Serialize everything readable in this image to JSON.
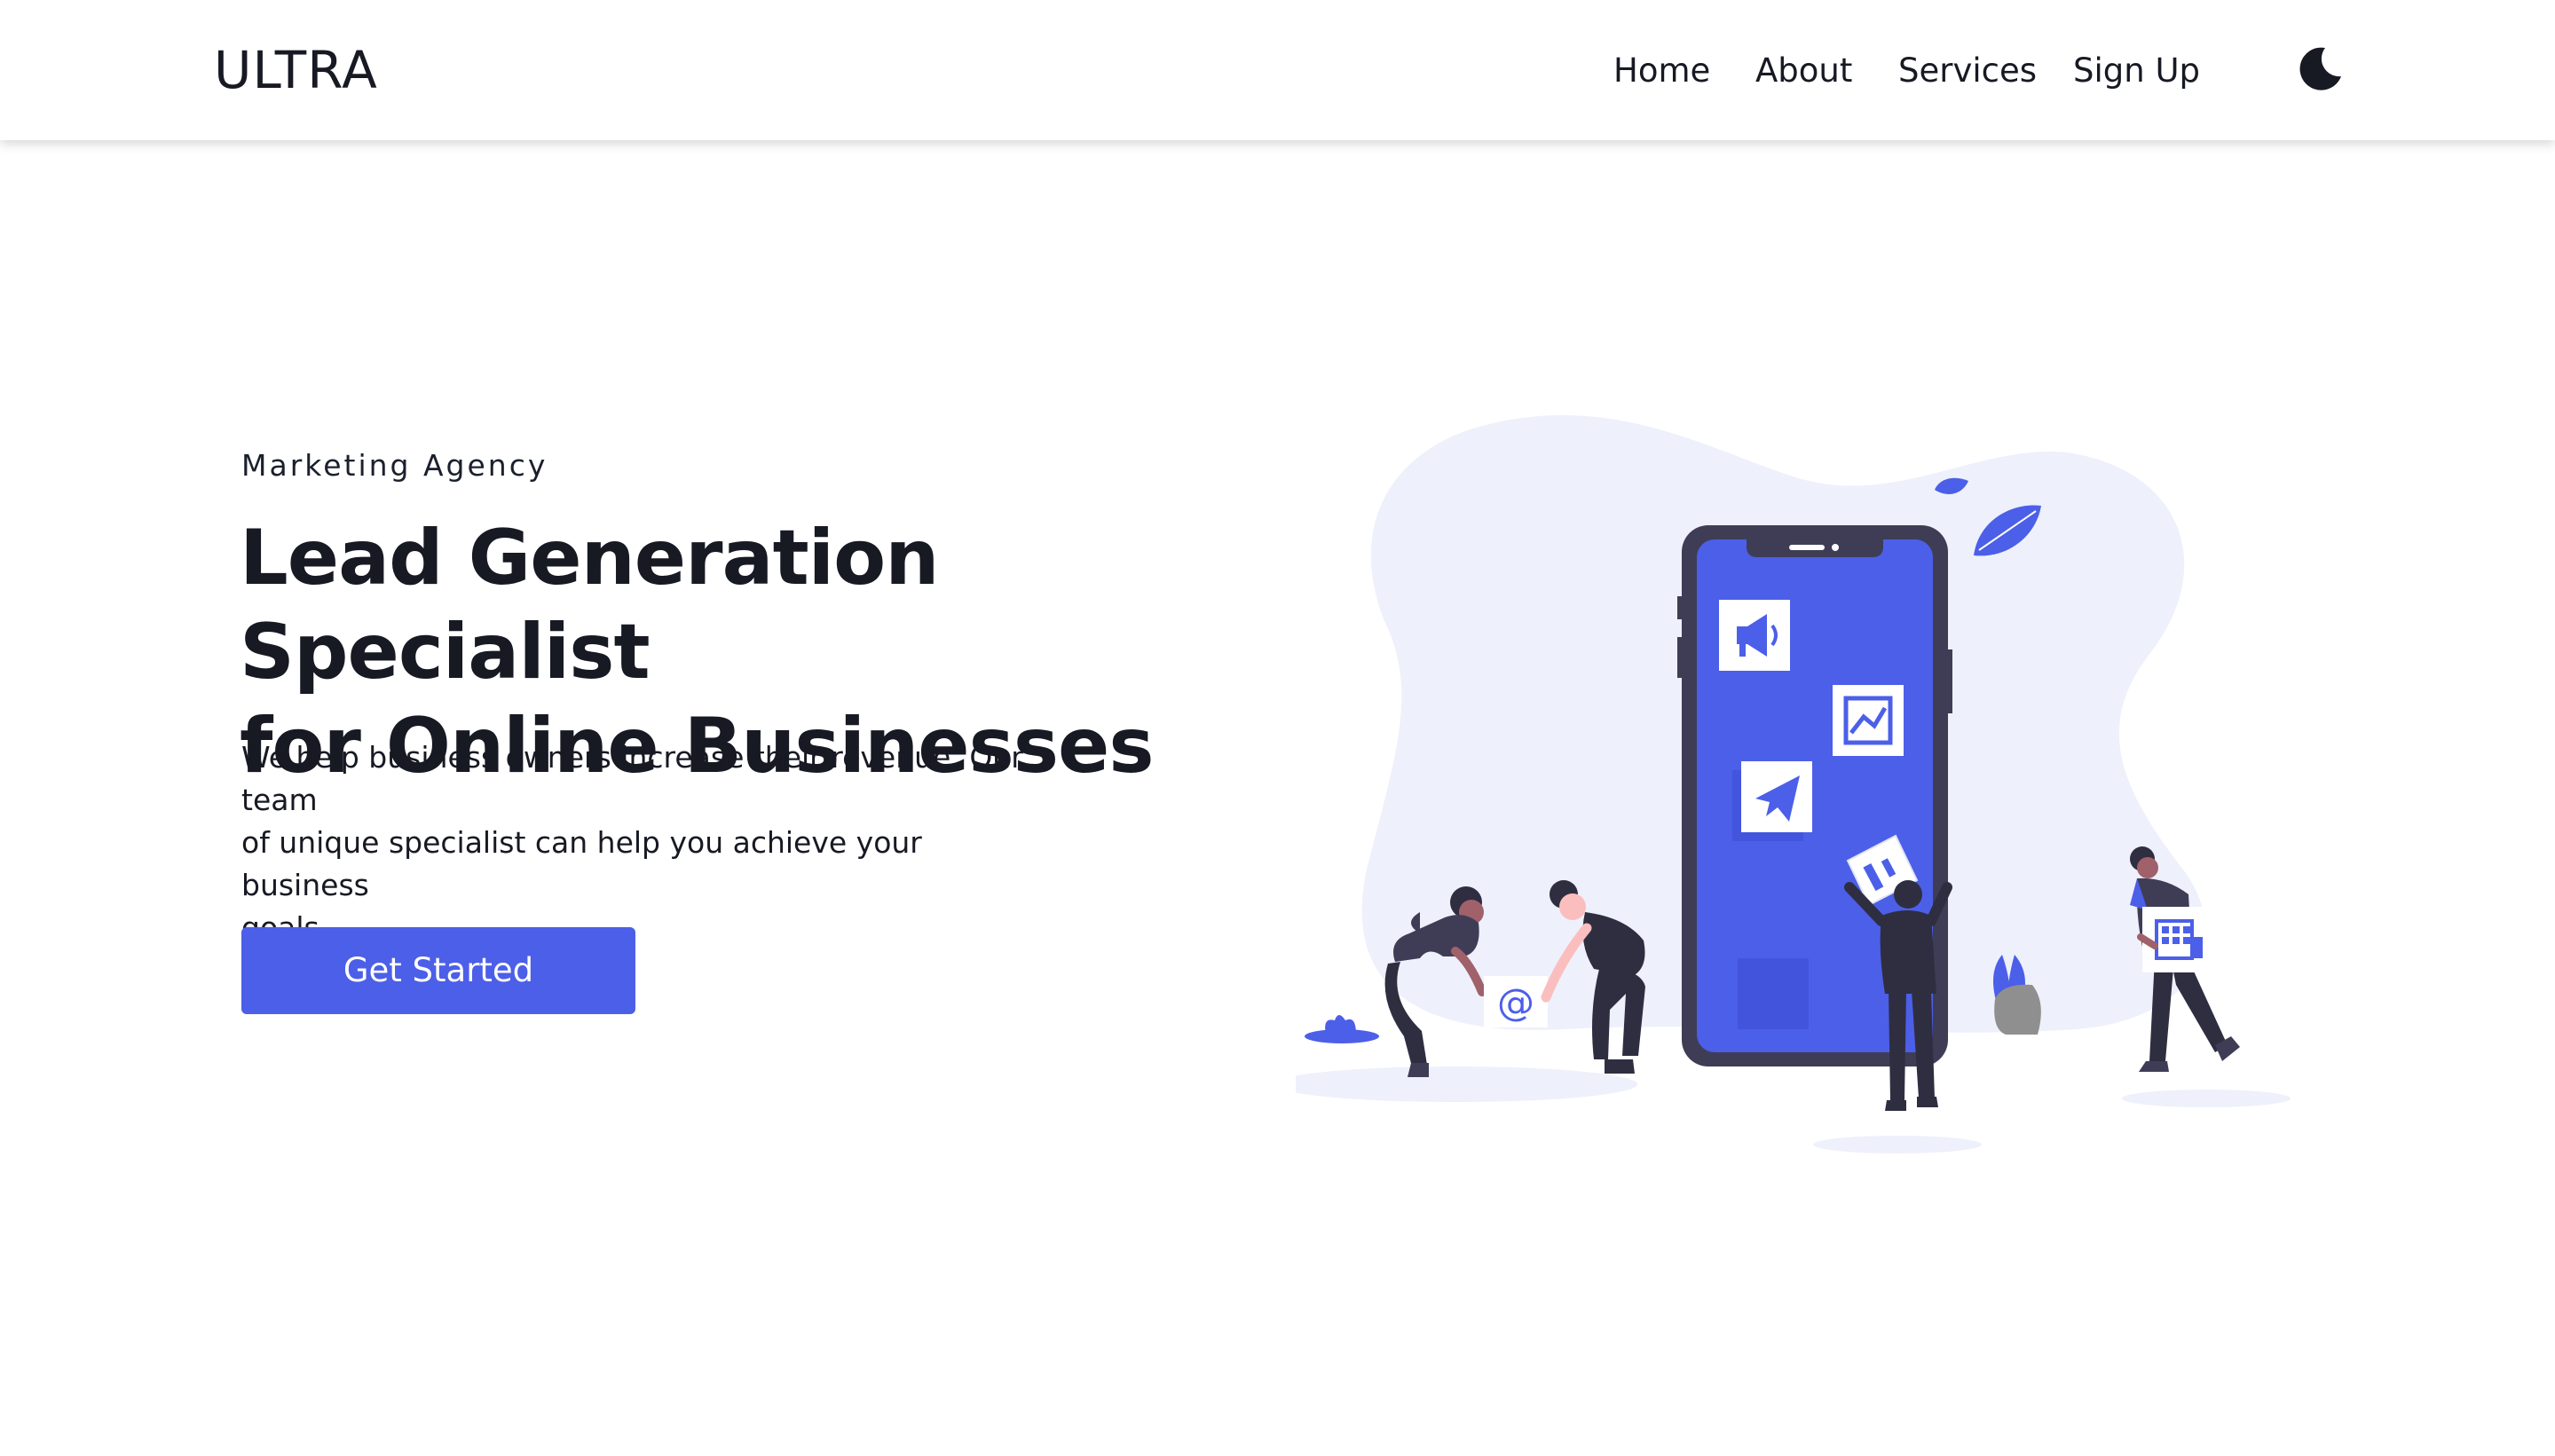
{
  "header": {
    "brand": "ULTRA",
    "nav": [
      "Home",
      "About",
      "Services",
      "Sign Up"
    ],
    "theme_toggle_icon": "moon-icon"
  },
  "hero": {
    "eyebrow": "Marketing Agency",
    "title_line1": "Lead Generation Specialist",
    "title_line2": "for Online Businesses",
    "subtitle_line1": "We help business owners increase their revenue. Our team",
    "subtitle_line2": "of unique specialist can help you achieve your business",
    "subtitle_line3": "goals.",
    "cta_label": "Get Started",
    "illustration_text": "@",
    "illustration_icons": [
      "megaphone-icon",
      "chart-icon",
      "paper-plane-icon",
      "building-icon"
    ]
  },
  "colors": {
    "accent": "#4c5fe8",
    "text": "#171923",
    "blob": "#eef0fb",
    "phone_frame": "#3f3d56"
  }
}
